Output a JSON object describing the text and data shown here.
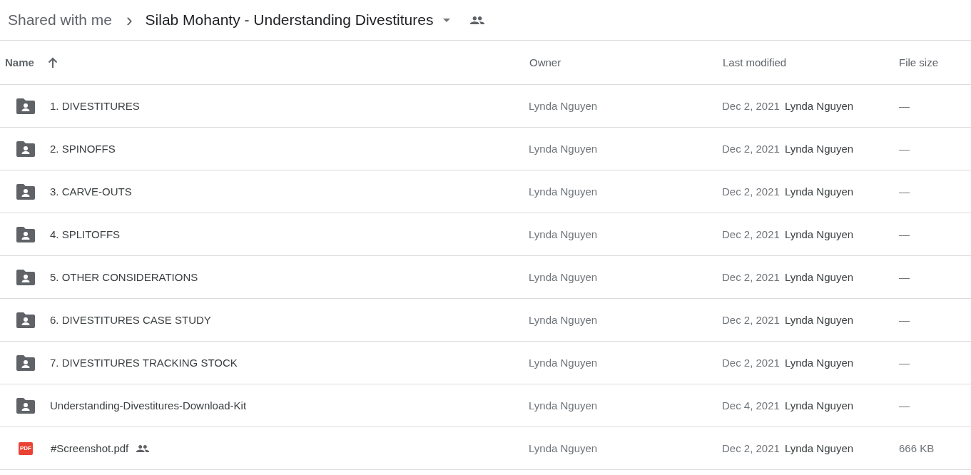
{
  "breadcrumb": {
    "parent": "Shared with me",
    "separator": "›",
    "current": "Silab Mohanty - Understanding Divestitures"
  },
  "columns": [
    {
      "label": "Name",
      "sorted": true
    },
    {
      "label": "Owner",
      "sorted": false
    },
    {
      "label": "Last modified",
      "sorted": false
    },
    {
      "label": "File size",
      "sorted": false
    }
  ],
  "rows": [
    {
      "kind": "folder",
      "name": "1. DIVESTITURES",
      "shared": false,
      "owner": "Lynda Nguyen",
      "date": "Dec 2, 2021",
      "modifier": "Lynda Nguyen",
      "size": "—"
    },
    {
      "kind": "folder",
      "name": "2. SPINOFFS",
      "shared": false,
      "owner": "Lynda Nguyen",
      "date": "Dec 2, 2021",
      "modifier": "Lynda Nguyen",
      "size": "—"
    },
    {
      "kind": "folder",
      "name": "3. CARVE-OUTS",
      "shared": false,
      "owner": "Lynda Nguyen",
      "date": "Dec 2, 2021",
      "modifier": "Lynda Nguyen",
      "size": "—"
    },
    {
      "kind": "folder",
      "name": "4. SPLITOFFS",
      "shared": false,
      "owner": "Lynda Nguyen",
      "date": "Dec 2, 2021",
      "modifier": "Lynda Nguyen",
      "size": "—"
    },
    {
      "kind": "folder",
      "name": "5. OTHER CONSIDERATIONS",
      "shared": false,
      "owner": "Lynda Nguyen",
      "date": "Dec 2, 2021",
      "modifier": "Lynda Nguyen",
      "size": "—"
    },
    {
      "kind": "folder",
      "name": "6. DIVESTITURES CASE STUDY",
      "shared": false,
      "owner": "Lynda Nguyen",
      "date": "Dec 2, 2021",
      "modifier": "Lynda Nguyen",
      "size": "—"
    },
    {
      "kind": "folder",
      "name": "7. DIVESTITURES TRACKING STOCK",
      "shared": false,
      "owner": "Lynda Nguyen",
      "date": "Dec 2, 2021",
      "modifier": "Lynda Nguyen",
      "size": "—"
    },
    {
      "kind": "folder",
      "name": "Understanding-Divestitures-Download-Kit",
      "shared": false,
      "owner": "Lynda Nguyen",
      "date": "Dec 4, 2021",
      "modifier": "Lynda Nguyen",
      "size": "—"
    },
    {
      "kind": "pdf",
      "icon_label": "PDF",
      "name": "#Screenshot.pdf",
      "shared": true,
      "owner": "Lynda Nguyen",
      "date": "Dec 2, 2021",
      "modifier": "Lynda Nguyen",
      "size": "666 KB"
    }
  ]
}
